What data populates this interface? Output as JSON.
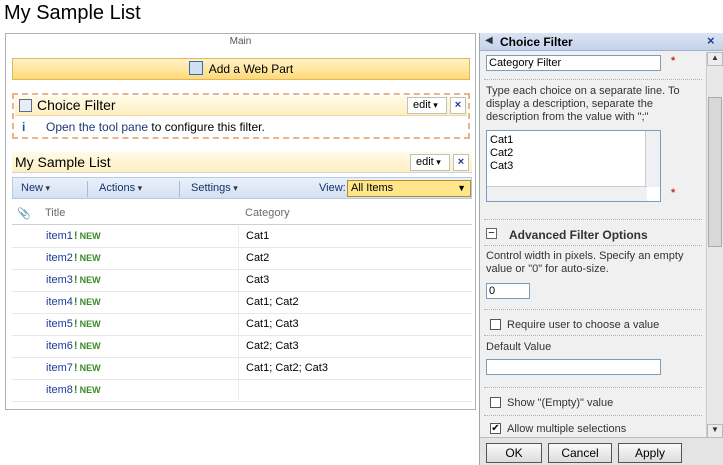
{
  "page": {
    "title": "My Sample List"
  },
  "zone": {
    "label": "Main",
    "add_webpart": "Add a Web Part"
  },
  "choice_filter_part": {
    "title": "Choice Filter",
    "edit": "edit",
    "close": "×",
    "info_icon": "i",
    "message_link": "Open the tool pane",
    "message_rest": " to configure this filter."
  },
  "list_part": {
    "title": "My Sample List",
    "edit": "edit",
    "close": "×",
    "toolbar": {
      "new": "New",
      "actions": "Actions",
      "settings": "Settings",
      "view_label": "View:",
      "view_value": "All Items"
    },
    "columns": {
      "title": "Title",
      "category": "Category"
    },
    "new_badge": "NEW",
    "rows": [
      {
        "title": "item1",
        "category": "Cat1"
      },
      {
        "title": "item2",
        "category": "Cat2"
      },
      {
        "title": "item3",
        "category": "Cat3"
      },
      {
        "title": "item4",
        "category": "Cat1; Cat2"
      },
      {
        "title": "item5",
        "category": "Cat1; Cat3"
      },
      {
        "title": "item6",
        "category": "Cat2; Cat3"
      },
      {
        "title": "item7",
        "category": "Cat1; Cat2; Cat3"
      },
      {
        "title": "item8",
        "category": ""
      }
    ]
  },
  "tool_pane": {
    "title": "Choice Filter",
    "back": "◀",
    "close": "×",
    "filter_name_value": "Category Filter",
    "required_mark": "*",
    "help_text": "Type each choice on a separate line. To display a description, separate the description from the value with \";\"",
    "choices": [
      "Cat1",
      "Cat2",
      "Cat3"
    ],
    "advanced_toggle": "−",
    "advanced_title": "Advanced Filter Options",
    "width_help": "Control width in pixels. Specify an empty value or \"0\" for auto-size.",
    "width_value": "0",
    "require_label": "Require user to choose a value",
    "require_checked": false,
    "default_label": "Default Value",
    "default_value": "",
    "show_empty_label": "Show \"(Empty)\" value",
    "show_empty_checked": false,
    "multi_label": "Allow multiple selections",
    "multi_checked": true,
    "buttons": {
      "ok": "OK",
      "cancel": "Cancel",
      "apply": "Apply"
    }
  }
}
